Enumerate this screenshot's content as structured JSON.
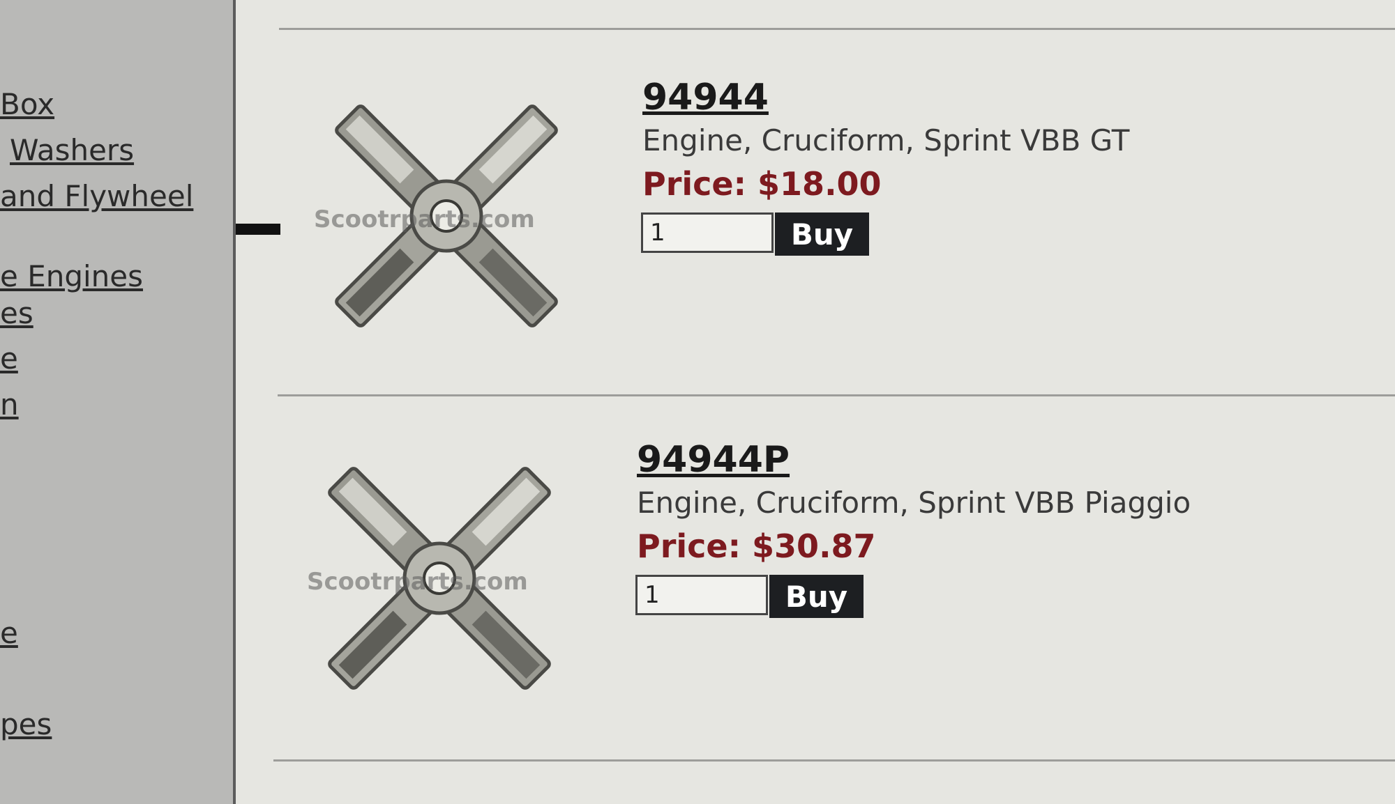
{
  "sidebar": {
    "links": [
      "Box",
      "Washers",
      "and Flywheel",
      "e Engines",
      "es",
      "e",
      "n",
      "e",
      "pes"
    ]
  },
  "products": [
    {
      "sku": "94944",
      "description": "Engine, Cruciform, Sprint VBB GT",
      "price": "Price: $18.00",
      "quantity": "1",
      "buy_label": "Buy",
      "watermark": "Scootrparts.com"
    },
    {
      "sku": "94944P",
      "description": "Engine, Cruciform, Sprint VBB Piaggio",
      "price": "Price: $30.87",
      "quantity": "1",
      "buy_label": "Buy",
      "watermark": "Scootrparts.com"
    }
  ]
}
